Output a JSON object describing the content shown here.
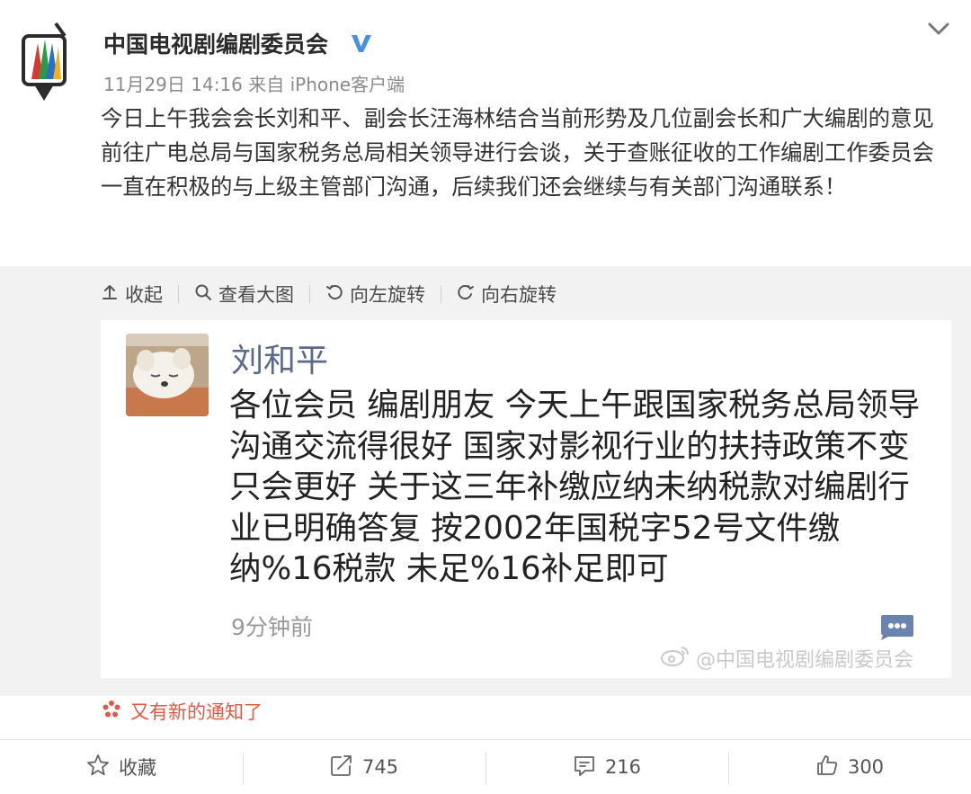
{
  "post": {
    "account_name": "中国电视剧编剧委员会",
    "meta": "11月29日 14:16 来自 iPhone客户端",
    "text": "今日上午我会会长刘和平、副会长汪海林结合当前形势及几位副会长和广大编剧的意见前往广电总局与国家税务总局相关领导进行会谈，关于查账征收的工作编剧工作委员会一直在积极的与上级主管部门沟通，后续我们还会继续与有关部门沟通联系！"
  },
  "image_toolbar": {
    "collapse": "收起",
    "view_large": "查看大图",
    "rotate_left": "向左旋转",
    "rotate_right": "向右旋转"
  },
  "embedded_screenshot": {
    "name": "刘和平",
    "message": "各位会员 编剧朋友 今天上午跟国家税务总局领导沟通交流得很好 国家对影视行业的扶持政策不变 只会更好 关于这三年补缴应纳未纳税款对编剧行业已明确答复 按2002年国税字52号文件缴纳%16税款 未足%16补足即可",
    "time": "9分钟前",
    "watermark": "@中国电视剧编剧委员会"
  },
  "notification": "又有新的通知了",
  "actions": {
    "favorite": "收藏",
    "repost_count": "745",
    "comment_count": "216",
    "like_count": "300"
  },
  "icons": {
    "verified": "verified-v-icon",
    "chevron": "chevron-down-icon",
    "collapse": "collapse-up-icon",
    "magnifier": "search-icon",
    "rotate_left": "rotate-left-icon",
    "rotate_right": "rotate-right-icon",
    "star": "star-icon",
    "repost": "repost-icon",
    "comment": "comment-icon",
    "like": "thumbs-up-icon",
    "weibo": "weibo-logo-icon",
    "notice": "notice-flower-icon"
  },
  "colors": {
    "verified": "#4a90e2",
    "notice": "#e05a44",
    "name_in_screenshot": "#5a6a8a"
  }
}
